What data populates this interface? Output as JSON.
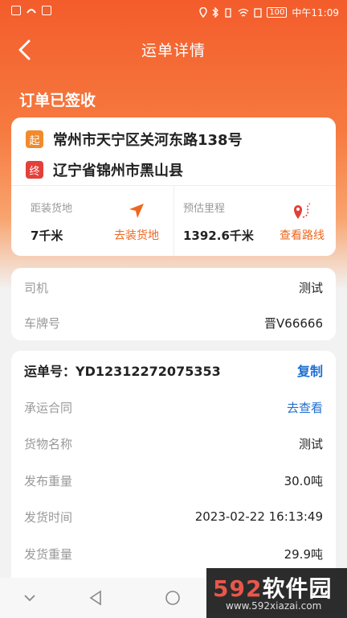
{
  "status_bar": {
    "battery": "100",
    "time": "中午11:09"
  },
  "app_bar": {
    "title": "运单详情"
  },
  "order_status": "订单已签收",
  "route": {
    "start_tag": "起",
    "start_address": "常州市天宁区关河东路138号",
    "end_tag": "终",
    "end_address": "辽宁省锦州市黑山县",
    "distance_label": "距装货地",
    "distance_value": "7千米",
    "go_loading_label": "去装货地",
    "mileage_label": "预估里程",
    "mileage_value": "1392.6千米",
    "view_route_label": "查看路线"
  },
  "driver_info": {
    "driver_label": "司机",
    "driver_value": "测试",
    "plate_label": "车牌号",
    "plate_value": "晋V66666"
  },
  "waybill": {
    "number_text": "运单号：YD12312272075353",
    "copy_label": "复制",
    "rows": [
      {
        "label": "承运合同",
        "value": "去查看"
      },
      {
        "label": "货物名称",
        "value": "测试"
      },
      {
        "label": "发布重量",
        "value": "30.0吨"
      },
      {
        "label": "发货时间",
        "value": "2023-02-22 16:13:49"
      },
      {
        "label": "发货重量",
        "value": "29.9吨"
      }
    ]
  },
  "watermark": {
    "brand_num": "592",
    "brand_text": "软件园",
    "url": "www.592xiazai.com"
  },
  "colors": {
    "brand_orange": "#f35c2b",
    "start_tag": "#f28a2c",
    "end_tag": "#e2413a",
    "link_blue": "#1f6fd1"
  }
}
